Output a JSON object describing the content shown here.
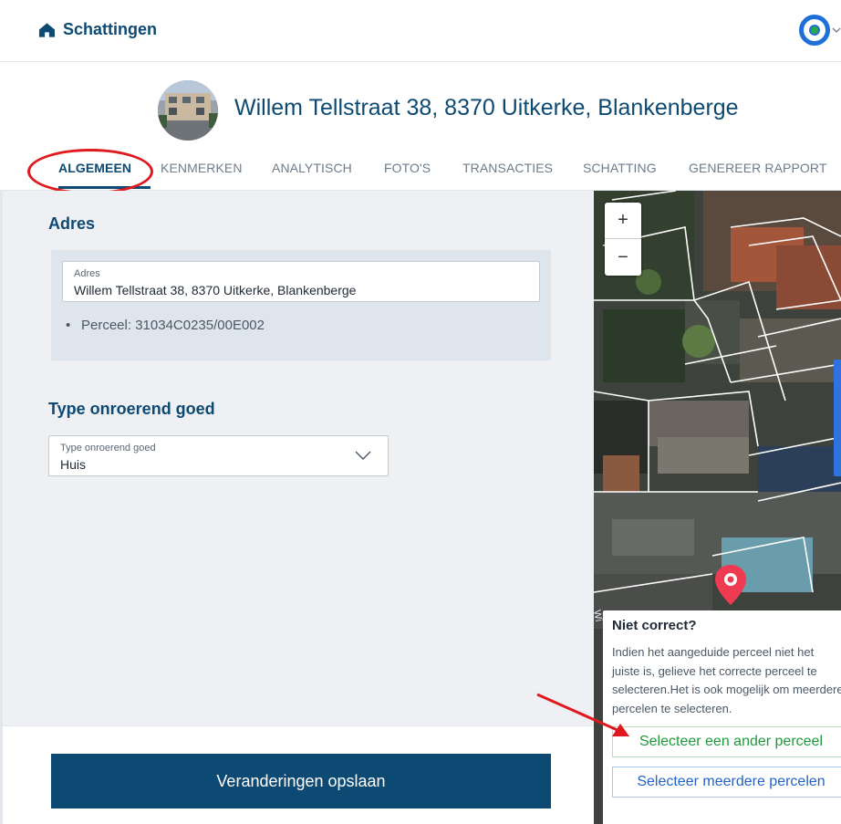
{
  "app": {
    "title": "Schattingen"
  },
  "property": {
    "address_title": "Willem Tellstraat 38, 8370 Uitkerke, Blankenberge"
  },
  "tabs": [
    {
      "label": "ALGEMEEN",
      "active": true
    },
    {
      "label": "KENMERKEN"
    },
    {
      "label": "ANALYTISCH"
    },
    {
      "label": "FOTO'S"
    },
    {
      "label": "TRANSACTIES"
    },
    {
      "label": "SCHATTING"
    },
    {
      "label": "GENEREER RAPPORT"
    }
  ],
  "adres": {
    "section_title": "Adres",
    "field_label": "Adres",
    "field_value": "Willem Tellstraat 38, 8370 Uitkerke, Blankenberge",
    "perceel": "Perceel: 31034C0235/00E002"
  },
  "type": {
    "section_title": "Type onroerend goed",
    "field_label": "Type onroerend goed",
    "field_value": "Huis"
  },
  "footer": {
    "save_label": "Veranderingen opslaan"
  },
  "map": {
    "zoom_in": "+",
    "zoom_out": "−",
    "popup": {
      "title": "Niet correct?",
      "text": "Indien het aangeduide perceel niet het juiste is, gelieve het correcte perceel te selecteren.Het is ook mogelijk om meerdere percelen te selecteren.",
      "select_other": "Selecteer een ander perceel",
      "select_multiple": "Selecteer meerdere percelen"
    }
  },
  "colors": {
    "primary": "#0d4a73",
    "annotation_red": "#e0191f",
    "green": "#1e9a3c",
    "blue": "#2363c9",
    "panel_bg": "#eef0f3"
  }
}
